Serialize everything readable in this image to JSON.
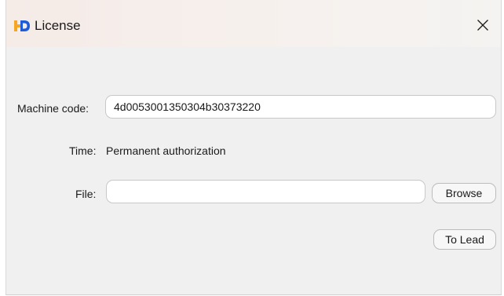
{
  "window": {
    "title": "License",
    "logo_icon": "hd-logo-icon",
    "close_icon": "close-icon",
    "accent_orange": "#f5a623",
    "accent_blue": "#1e5bd6"
  },
  "form": {
    "machine_code_label": "Machine code:",
    "machine_code_value": "4d0053001350304b30373220",
    "time_label": "Time:",
    "time_value": "Permanent authorization",
    "file_label": "File:",
    "file_value": "",
    "browse_label": "Browse",
    "to_lead_label": "To Lead"
  }
}
